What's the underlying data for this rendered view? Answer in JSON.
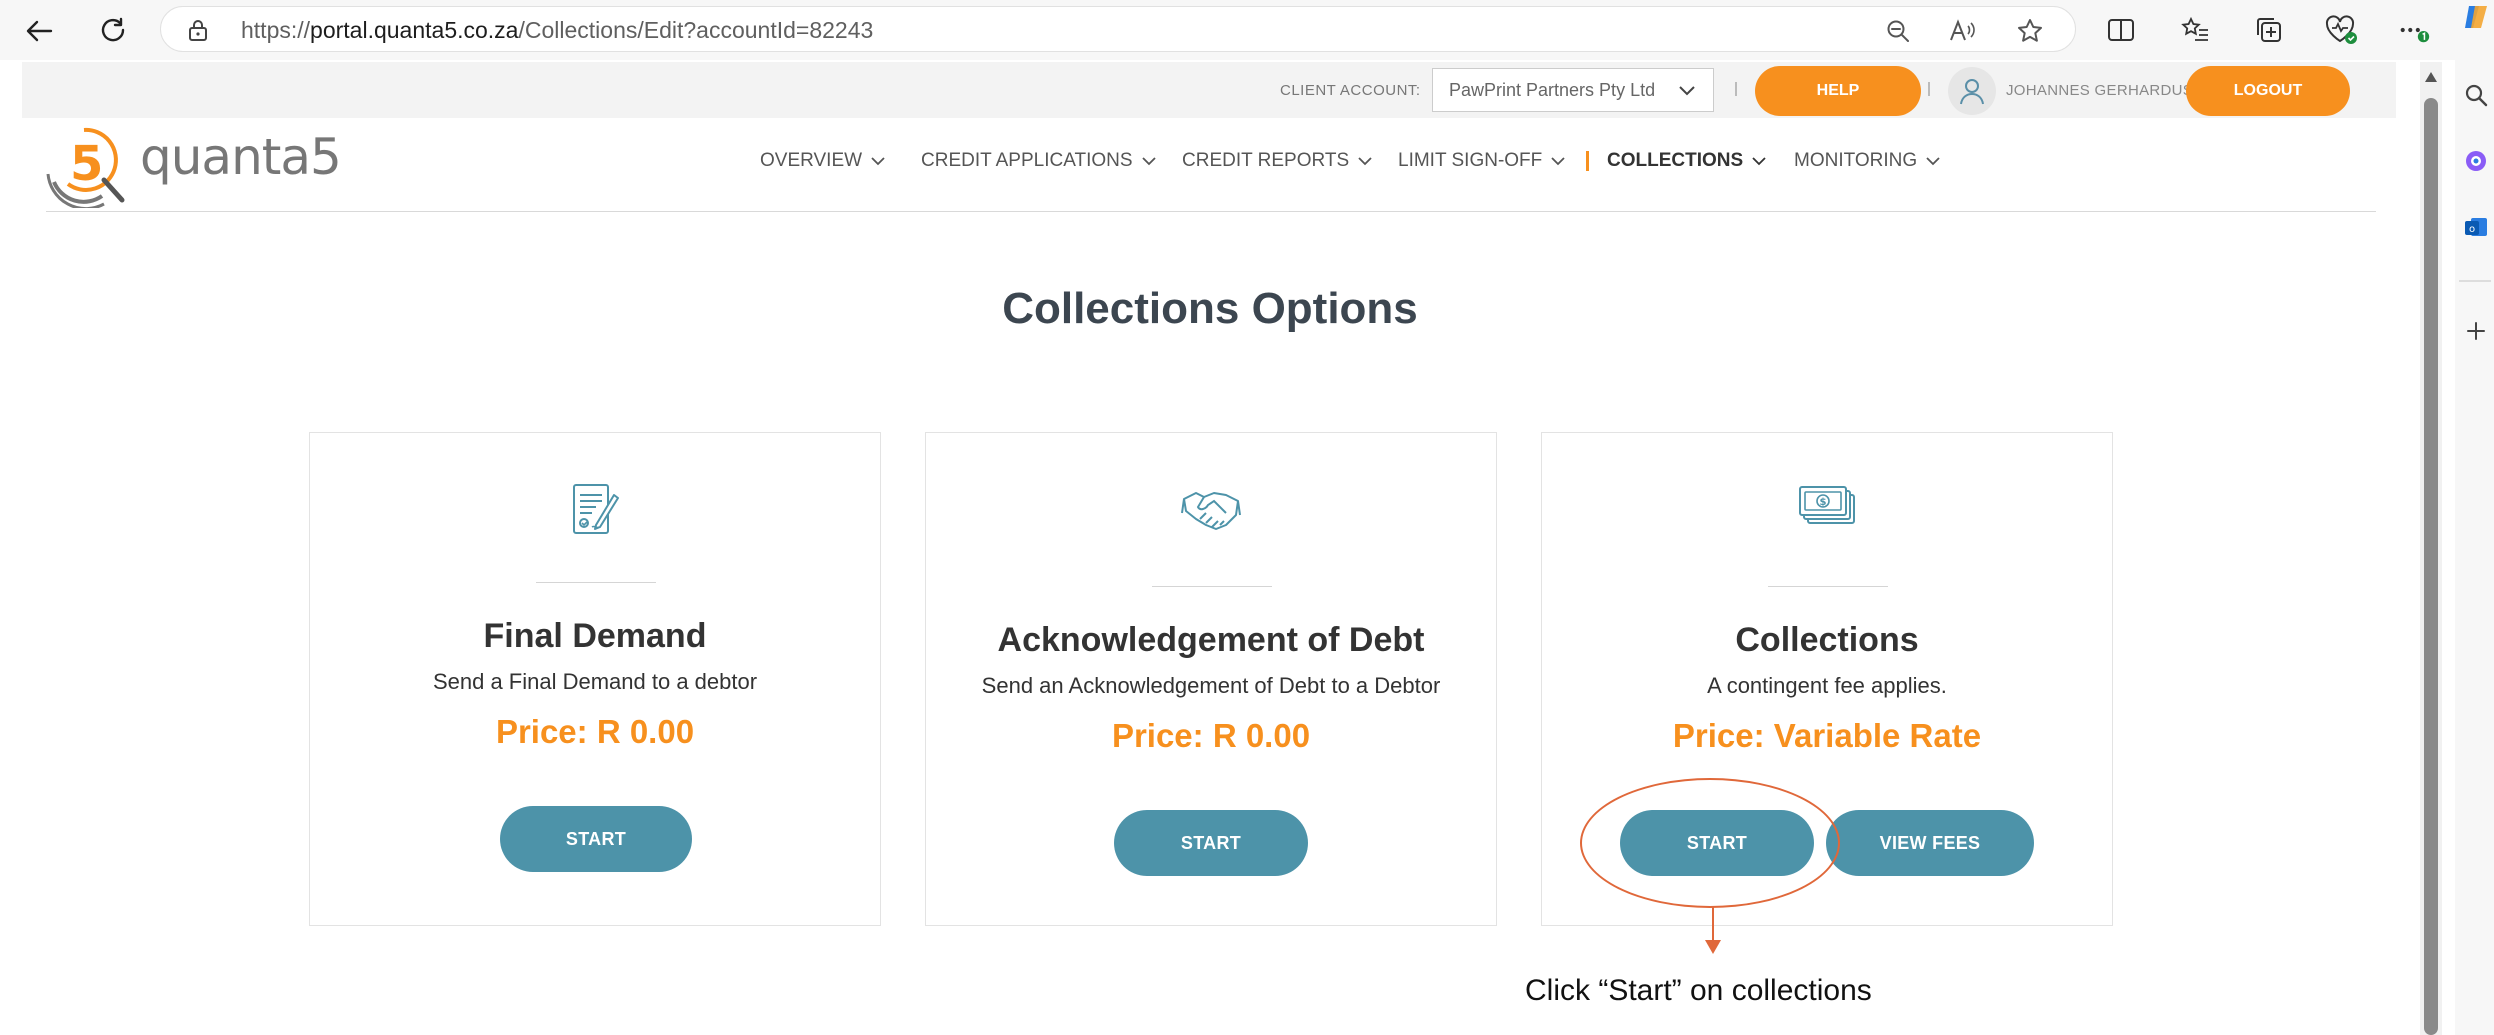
{
  "browser": {
    "url_prefix": "https://",
    "url_host": "portal.quanta5.co.za",
    "url_path": "/Collections/Edit?accountId=82243"
  },
  "topbar": {
    "client_label": "CLIENT ACCOUNT:",
    "client_value": "PawPrint Partners Pty Ltd",
    "help_label": "HELP",
    "user_name": "JOHANNES GERHARDUS",
    "logout_label": "LOGOUT"
  },
  "brand": {
    "name": "quanta5",
    "accent": "#f7901e"
  },
  "nav": {
    "items": [
      {
        "label": "OVERVIEW"
      },
      {
        "label": "CREDIT APPLICATIONS"
      },
      {
        "label": "CREDIT REPORTS"
      },
      {
        "label": "LIMIT SIGN-OFF"
      },
      {
        "label": "COLLECTIONS",
        "active": true
      },
      {
        "label": "MONITORING"
      }
    ]
  },
  "main": {
    "title": "Collections Options",
    "cards": [
      {
        "icon": "document-sign-icon",
        "title": "Final Demand",
        "description": "Send a Final Demand to a debtor",
        "price": "Price: R 0.00",
        "start_label": "START"
      },
      {
        "icon": "handshake-icon",
        "title": "Acknowledgement of Debt",
        "description": "Send an Acknowledgement of Debt to a Debtor",
        "price": "Price: R 0.00",
        "start_label": "START"
      },
      {
        "icon": "money-stack-icon",
        "title": "Collections",
        "description": "A contingent fee applies.",
        "price": "Price: Variable Rate",
        "start_label": "START",
        "view_fees_label": "VIEW FEES"
      }
    ]
  },
  "annotation": {
    "text": "Click “Start” on collections",
    "color": "#e0683a"
  },
  "colors": {
    "button": "#4d93a9",
    "price": "#f7901e",
    "title": "#3c4650"
  }
}
